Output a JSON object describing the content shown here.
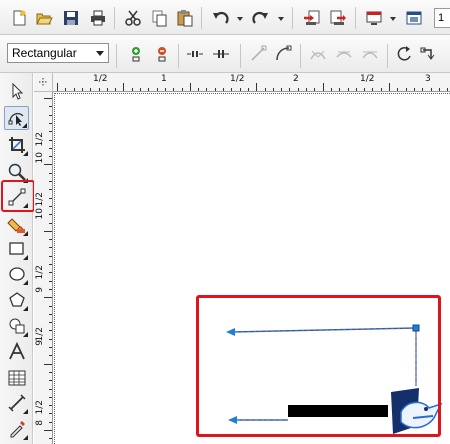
{
  "toolbar_main": {
    "buttons": [
      {
        "name": "new-document-button",
        "icon": "new-document-icon"
      },
      {
        "name": "open-button",
        "icon": "folder-open-icon"
      },
      {
        "name": "save-button",
        "icon": "save-icon"
      },
      {
        "name": "print-button",
        "icon": "printer-icon"
      },
      {
        "name": "cut-button",
        "icon": "scissors-icon"
      },
      {
        "name": "copy-button",
        "icon": "copy-icon"
      },
      {
        "name": "paste-button",
        "icon": "paste-icon"
      },
      {
        "name": "undo-button",
        "icon": "undo-icon"
      },
      {
        "name": "redo-button",
        "icon": "redo-icon"
      },
      {
        "name": "import-button",
        "icon": "import-icon"
      },
      {
        "name": "export-button",
        "icon": "export-icon"
      },
      {
        "name": "application-launcher-button",
        "icon": "launcher-icon"
      },
      {
        "name": "welcome-screen-button",
        "icon": "window-icon"
      }
    ],
    "zoom_value": "1"
  },
  "property_bar": {
    "connector_style": "Rectangular",
    "buttons": [
      {
        "name": "add-node-button",
        "icon": "add-node-icon"
      },
      {
        "name": "delete-node-button",
        "icon": "delete-node-icon"
      },
      {
        "name": "break-node-button",
        "icon": "break-node-icon"
      },
      {
        "name": "join-node-button",
        "icon": "join-node-icon"
      },
      {
        "name": "to-line-button",
        "icon": "to-line-icon"
      },
      {
        "name": "to-curve-button",
        "icon": "to-curve-icon"
      },
      {
        "name": "cusp-node-button",
        "icon": "cusp-icon"
      },
      {
        "name": "smooth-node-button",
        "icon": "smooth-icon"
      },
      {
        "name": "symmetric-node-button",
        "icon": "symmetric-icon"
      },
      {
        "name": "reverse-direction-button",
        "icon": "reverse-icon"
      },
      {
        "name": "extend-curve-button",
        "icon": "extend-icon"
      }
    ]
  },
  "toolbox": {
    "tools": [
      {
        "name": "pick-tool",
        "icon": "pointer-icon"
      },
      {
        "name": "shape-tool",
        "icon": "shape-edit-icon",
        "active": true
      },
      {
        "name": "crop-tool",
        "icon": "crop-icon"
      },
      {
        "name": "zoom-tool",
        "icon": "magnifier-icon"
      },
      {
        "name": "connector-tool",
        "icon": "connector-line-icon"
      },
      {
        "name": "smart-fill-tool",
        "icon": "smart-fill-icon"
      },
      {
        "name": "rectangle-tool",
        "icon": "rectangle-icon"
      },
      {
        "name": "ellipse-tool",
        "icon": "ellipse-icon"
      },
      {
        "name": "polygon-tool",
        "icon": "polygon-icon"
      },
      {
        "name": "basic-shapes-tool",
        "icon": "basic-shapes-icon"
      },
      {
        "name": "text-tool",
        "icon": "text-a-icon"
      },
      {
        "name": "table-tool",
        "icon": "table-icon"
      },
      {
        "name": "dimension-tool",
        "icon": "dimension-icon"
      },
      {
        "name": "interactive-fill-tool",
        "icon": "dropper-icon"
      }
    ]
  },
  "ruler_top": {
    "labels": [
      "1/2",
      "1",
      "1/2",
      "2",
      "1/2",
      "3"
    ]
  },
  "ruler_left": {
    "labels": [
      "1/2",
      "10",
      "1/2",
      "10",
      "1/2",
      "9",
      "1/2",
      "9",
      "1/2",
      "8"
    ]
  },
  "colors": {
    "highlight": "#e0141c",
    "connector_blue": "#1e7fd4",
    "connector_red": "#b02020",
    "toolbar_bg": "#efefef"
  }
}
